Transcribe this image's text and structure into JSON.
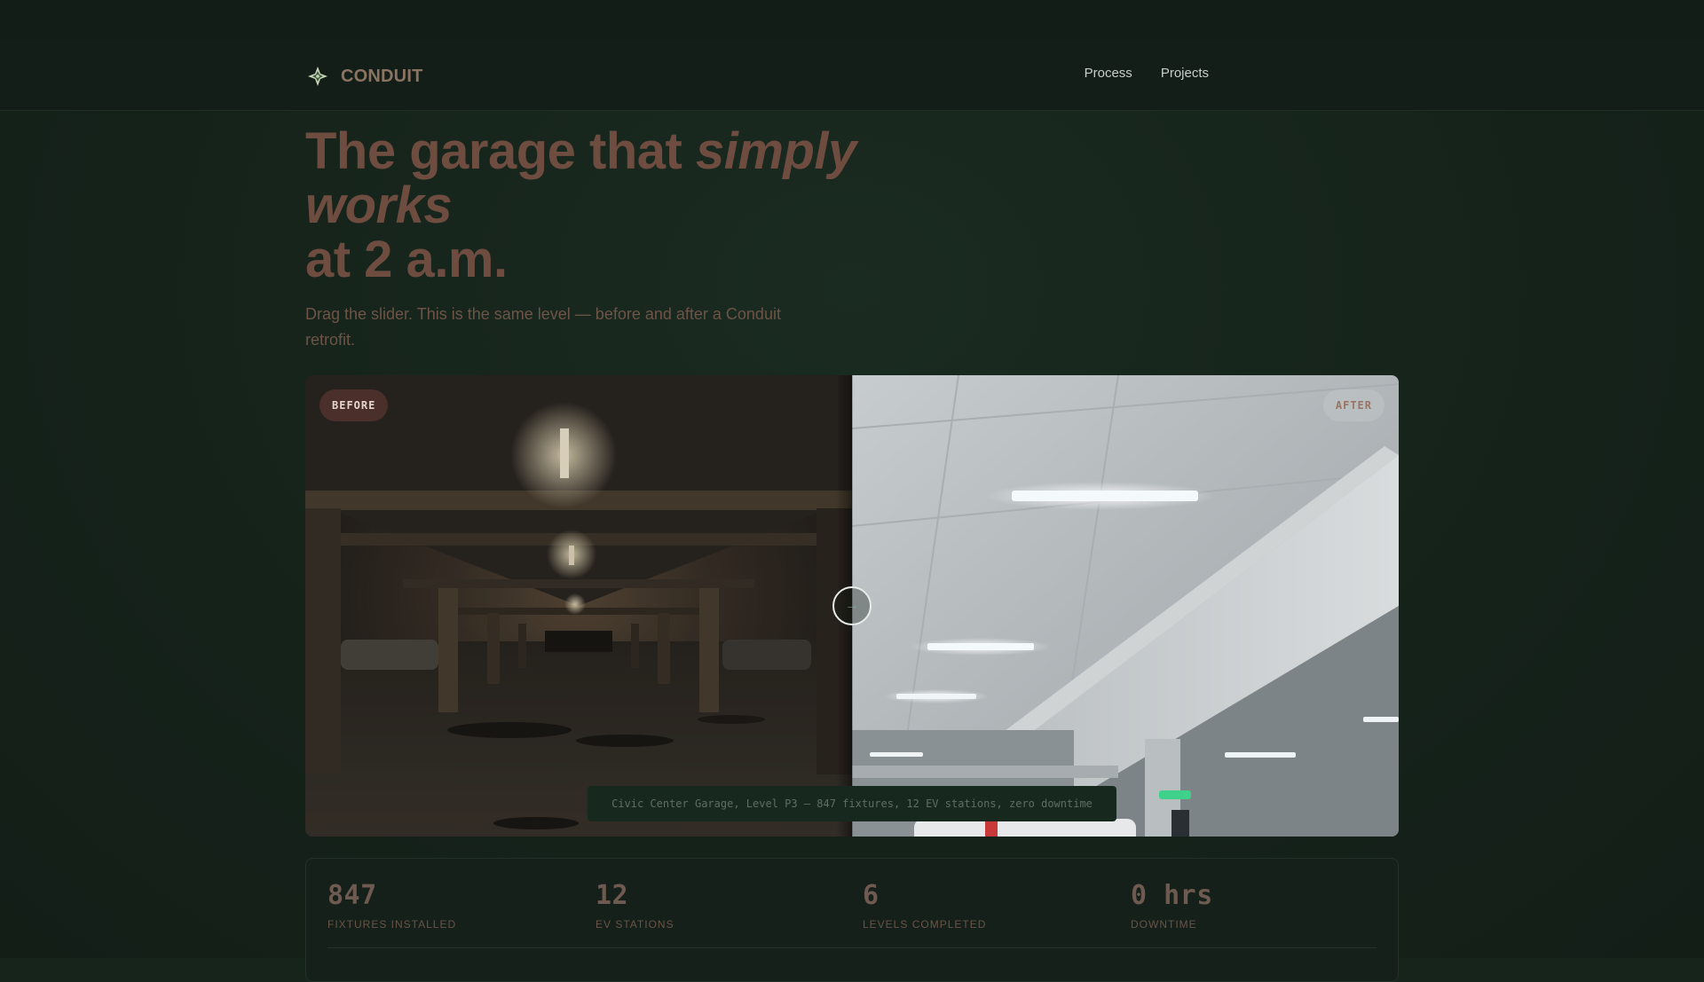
{
  "brand": {
    "name": "CONDUIT",
    "icon": "compass-star-icon",
    "accent": "#8a7360"
  },
  "nav": {
    "items": [
      {
        "label": "Process"
      },
      {
        "label": "Projects"
      }
    ]
  },
  "hero": {
    "title_part1": "The garage that ",
    "title_em1": "simply",
    "title_em2": "works",
    "title_line3": "at 2 a.m.",
    "subtitle": "Drag the slider. This is the same level — before and after a Conduit retrofit.",
    "title_color": "#6e4c3f"
  },
  "compare": {
    "before_label": "BEFORE",
    "after_label": "AFTER",
    "handle_icon": "arrow-right-icon",
    "handle_glyph": "→",
    "caption": "Civic Center Garage, Level P3 — 847 fixtures, 12 EV stations, zero downtime",
    "slider_position": 0.5
  },
  "stats": [
    {
      "value": "847",
      "label": "FIXTURES INSTALLED"
    },
    {
      "value": "12",
      "label": "EV STATIONS"
    },
    {
      "value": "6",
      "label": "LEVELS COMPLETED"
    },
    {
      "value": "0 hrs",
      "label": "DOWNTIME"
    }
  ]
}
